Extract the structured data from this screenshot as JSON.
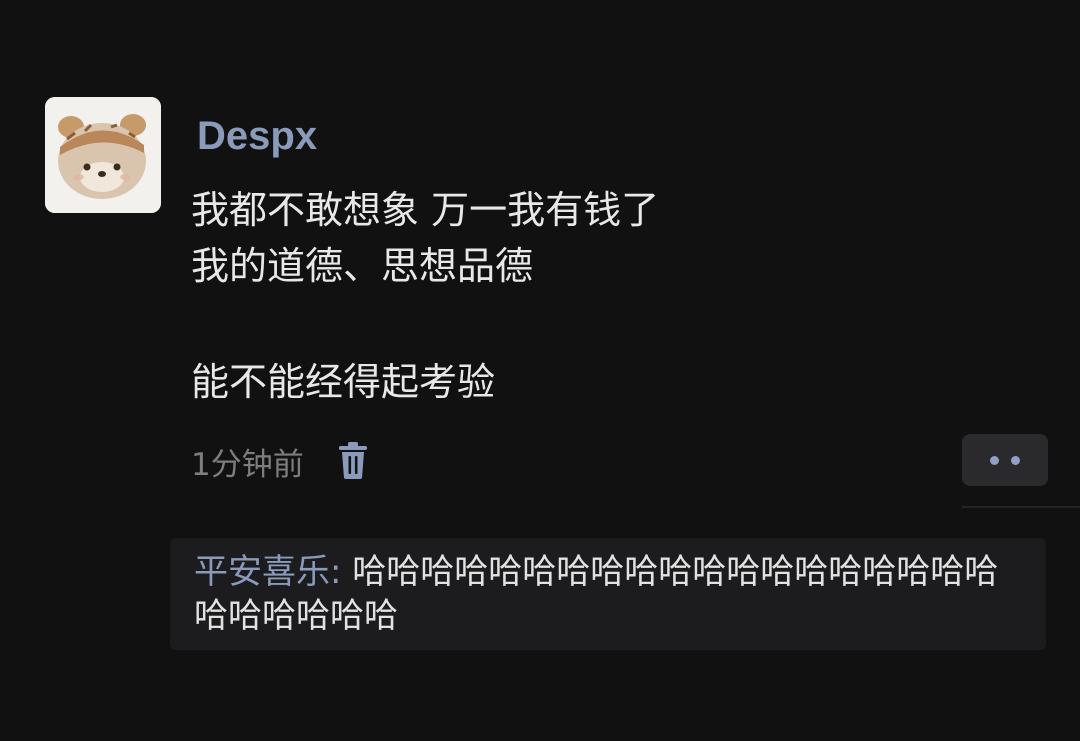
{
  "post": {
    "avatar": "bear-avatar",
    "username": "Despx",
    "lines": [
      "我都不敢想象 万一我有钱了",
      "我的道德、思想品德",
      "能不能经得起考验"
    ],
    "timestamp": "1分钟前",
    "delete_icon": "trash-icon",
    "more_icon": "more-dots-icon"
  },
  "comments": [
    {
      "author": "平安喜乐",
      "separator": ": ",
      "text": "哈哈哈哈哈哈哈哈哈哈哈哈哈哈哈哈哈哈哈哈哈哈哈哈哈"
    }
  ],
  "colors": {
    "background": "#111111",
    "name_link": "#8a9aba",
    "text": "#e8e8e8",
    "muted": "#7d7d7d",
    "comment_bg": "#1c1c1e"
  }
}
